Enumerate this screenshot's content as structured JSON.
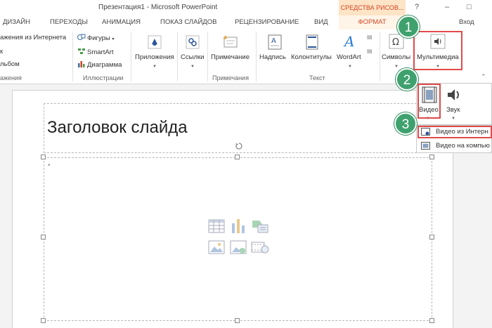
{
  "window": {
    "title": "Презентация1 - Microsoft PowerPoint",
    "tools_header": "СРЕДСТВА РИСОВ...",
    "question": "?",
    "minimize": "–",
    "restore": "□"
  },
  "tabs": {
    "design": "ДИЗАЙН",
    "transitions": "ПЕРЕХОДЫ",
    "animation": "АНИМАЦИЯ",
    "slideshow": "ПОКАЗ СЛАЙДОВ",
    "review": "РЕЦЕНЗИРОВАНИЕ",
    "view": "ВИД",
    "format": "ФОРМАТ",
    "login": "Вход"
  },
  "ribbon": {
    "images": {
      "online_images": "ажения из Интернета",
      "screenshot": "к",
      "album": "льбом",
      "group_label": "ажения"
    },
    "illustrations": {
      "shapes": "Фигуры",
      "smartart": "SmartArt",
      "chart": "Диаграмма",
      "group_label": "Иллюстрации"
    },
    "apps": {
      "label": "Приложения"
    },
    "links": {
      "label": "Ссылки"
    },
    "comments": {
      "label": "Примечание",
      "group_label": "Примечания"
    },
    "text": {
      "textbox": "Надпись",
      "header_footer": "Колонтитулы",
      "wordart": "WordArt",
      "group_label": "Текст"
    },
    "symbols": {
      "label": "Символы"
    },
    "media": {
      "label": "Мультимедиа"
    }
  },
  "media_menu": {
    "video": "Видео",
    "audio": "Звук",
    "online_video": "Видео из Интерн",
    "video_on_pc": "Видео на компью"
  },
  "slide": {
    "title": "Заголовок слайда"
  },
  "steps": [
    "1",
    "2",
    "3"
  ],
  "colors": {
    "highlight": "#e04a4a",
    "step_badge": "#3fa16e",
    "accent": "#d24726"
  }
}
